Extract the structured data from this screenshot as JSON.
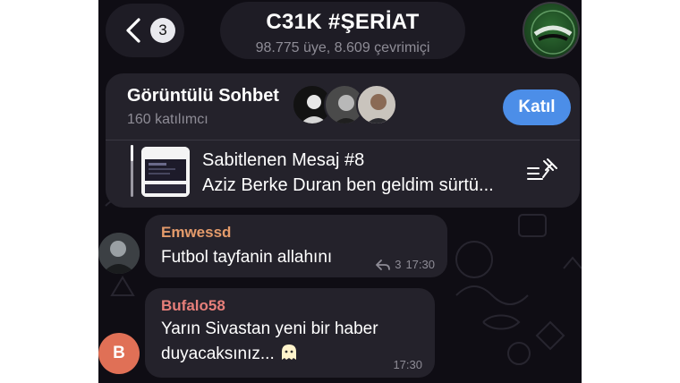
{
  "header": {
    "back_badge": "3",
    "title": "C31K #ŞERİAT",
    "subtitle": "98.775 üye, 8.609 çevrimiçi"
  },
  "video_chat": {
    "title": "Görüntülü Sohbet",
    "participants": "160 katılımcı",
    "join_label": "Katıl"
  },
  "pinned": {
    "title": "Sabitlenen Mesaj #8",
    "text": "Aziz Berke Duran ben geldim sürtü..."
  },
  "messages": [
    {
      "sender": "Emwessd",
      "text": "Futbol tayfanin allahını",
      "reply_count": "3",
      "time": "17:30"
    },
    {
      "sender": "Bufalo58",
      "text": "Yarın Sivastan yeni bir haber duyacaksınız...",
      "time": "17:30",
      "avatar_letter": "B"
    }
  ],
  "colors": {
    "background": "#0f0d14",
    "surface": "#24222b",
    "accent": "#4c8ee8",
    "sender1": "#e49b6b",
    "sender2": "#e77f7a",
    "avatar_letter_bg": "#e07056"
  }
}
